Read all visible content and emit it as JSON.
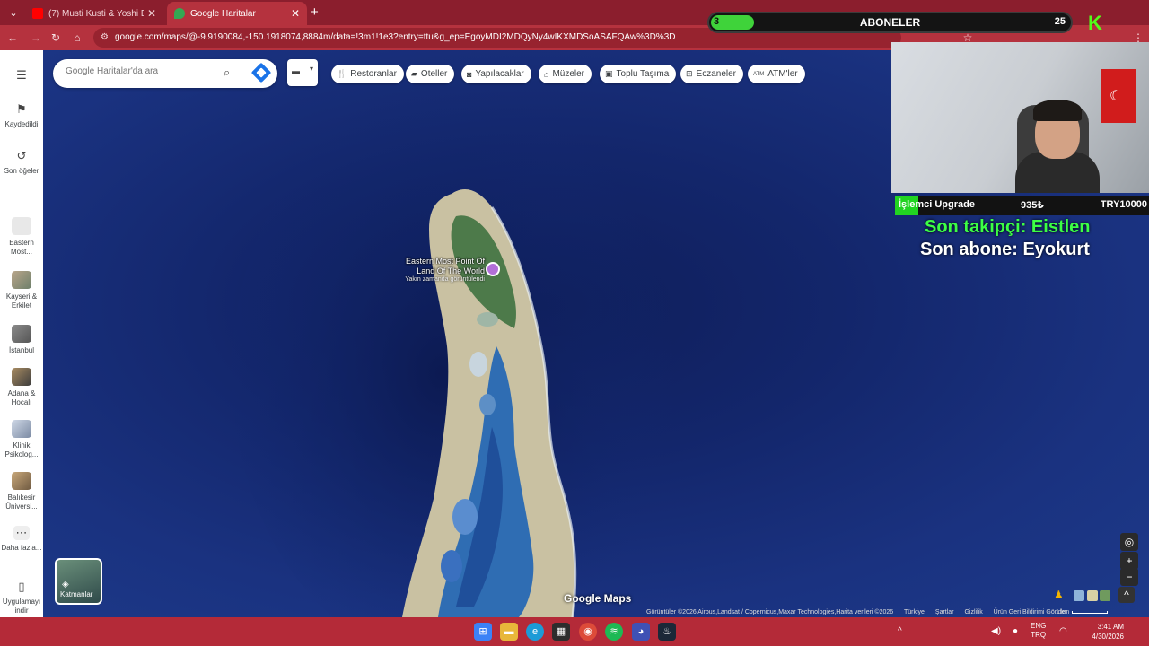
{
  "browser": {
    "tabs": [
      {
        "title": "(7) Musti Kusti & Yoshi Enomoto",
        "favicon_color": "#ff0000"
      },
      {
        "title": "Google Haritalar",
        "favicon_color": "#34a853"
      }
    ],
    "url": "google.com/maps/@-9.9190084,-150.1918074,8884m/data=!3m1!1e3?entry=ttu&g_ep=EgoyMDI2MDQyNy4wIKXMDSoASAFQAw%3D%3D"
  },
  "maps": {
    "search_placeholder": "Google Haritalar'da ara",
    "sidebar": [
      {
        "label": "Kaydedildi",
        "icon": "bookmark-icon"
      },
      {
        "label": "Son öğeler",
        "icon": "history-icon"
      },
      {
        "label": "Eastern Most...",
        "icon": "thumbnail"
      },
      {
        "label": "Kayseri & Erkilet",
        "icon": "thumbnail"
      },
      {
        "label": "İstanbul",
        "icon": "thumbnail"
      },
      {
        "label": "Adana & Hocalı",
        "icon": "thumbnail"
      },
      {
        "label": "Klinik Psikolog...",
        "icon": "thumbnail"
      },
      {
        "label": "Balıkesir Üniversi...",
        "icon": "thumbnail"
      },
      {
        "label": "Daha fazla...",
        "icon": "more-icon"
      },
      {
        "label": "Uygulamayı indir",
        "icon": "phone-icon"
      }
    ],
    "chips": [
      {
        "label": "Restoranlar",
        "icon": "restaurant-icon"
      },
      {
        "label": "Oteller",
        "icon": "hotel-icon"
      },
      {
        "label": "Yapılacaklar",
        "icon": "camera-icon"
      },
      {
        "label": "Müzeler",
        "icon": "museum-icon"
      },
      {
        "label": "Toplu Taşıma",
        "icon": "transit-icon"
      },
      {
        "label": "Eczaneler",
        "icon": "pharmacy-icon"
      },
      {
        "label": "ATM'ler",
        "icon": "atm-icon"
      }
    ],
    "poi": {
      "title": "Eastern Most Point Of Land Of The World",
      "subtitle": "Yakın zamanda görüntülendi"
    },
    "layers_label": "Katmanlar",
    "watermark": "Google Maps",
    "footer": {
      "imagery": "Görüntüler ©2026 Airbus,Landsat / Copernicus,Maxar Technologies,Harita verileri ©2026",
      "links": [
        "Türkiye",
        "Şartlar",
        "Gizlilik",
        "Ürün Geri Bildirimi Gönder"
      ],
      "scale": "1 km"
    }
  },
  "overlay": {
    "subs": {
      "label": "ABONELER",
      "current": "3",
      "goal": "25",
      "progress": 0.12
    },
    "goal": {
      "name": "İşlemci Upgrade",
      "current": "935₺",
      "target": "TRY10000"
    },
    "last_follower": {
      "label": "Son takipçi:",
      "name": "Eistlen"
    },
    "last_sub": {
      "label": "Son abone:",
      "name": "Eyokurt"
    }
  },
  "taskbar": {
    "lang": [
      "ENG",
      "TRQ"
    ],
    "time": "3:41 AM",
    "date": "4/30/2026"
  }
}
